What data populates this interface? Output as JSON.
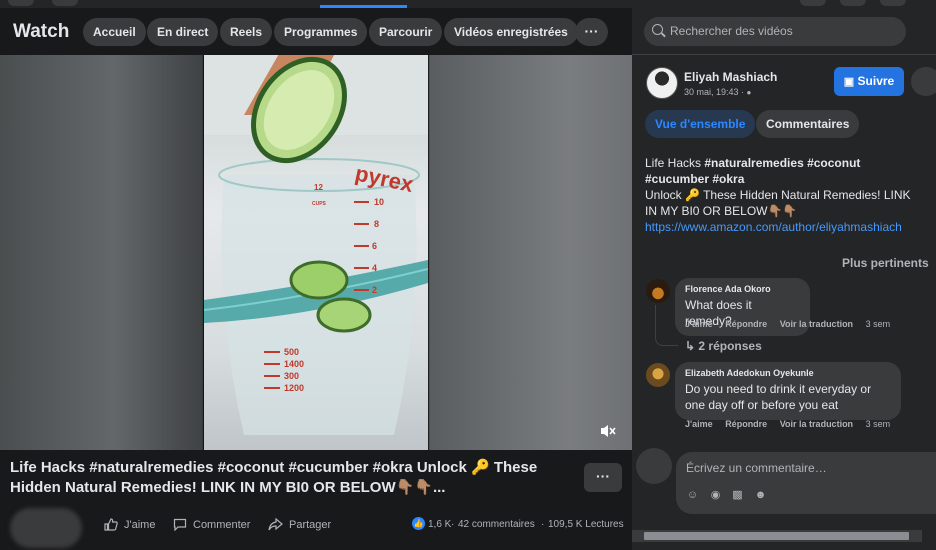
{
  "nav": {
    "title": "Watch",
    "tabs": [
      "Accueil",
      "En direct",
      "Reels",
      "Programmes",
      "Parcourir",
      "Vidéos enregistrées"
    ],
    "more": "···"
  },
  "search": {
    "placeholder": "Rechercher des vidéos"
  },
  "video": {
    "caption": "Life Hacks #naturalremedies #coconut #cucumber #okra Unlock 🔑 These Hidden Natural Remedies! LINK IN MY BI0 OR BELOW👇🏽👇🏽...",
    "more": "···",
    "actions": {
      "like": "J'aime",
      "comment": "Commenter",
      "share": "Partager"
    },
    "stats": {
      "reactions": "1,6 K",
      "comments": "42 commentaires",
      "views": "109,5 K Lectures",
      "separator": "·"
    },
    "beaker_brand": "pyrex",
    "beaker_marks": [
      "12",
      "CUPS",
      "10",
      "8",
      "6",
      "4",
      "2",
      "500",
      "1400",
      "300",
      "1200"
    ]
  },
  "post": {
    "author": "Eliyah Mashiach",
    "date": "30 mai, 19:43 · ",
    "follow": "Suivre",
    "tabs": {
      "overview": "Vue d'ensemble",
      "comments": "Commentaires"
    },
    "desc_prefix": "Life Hacks ",
    "desc_tags": "#naturalremedies #coconut #cucumber #okra",
    "desc_body": "Unlock 🔑 These Hidden Natural Remedies! LINK IN MY BI0 OR BELOW👇🏽👇🏽",
    "desc_link": "https://www.amazon.com/author/eliyahmashiach",
    "sort": "Plus pertinents"
  },
  "comments": [
    {
      "name": "Florence Ada Okoro",
      "text": "What does it remedy?",
      "like": "J'aime",
      "reply": "Répondre",
      "translate": "Voir la traduction",
      "time": "3 sem",
      "replies": "2 réponses"
    },
    {
      "name": "Elizabeth Adedokun Oyekunle",
      "text": "Do you need to drink it everyday or one day off or before you eat",
      "like": "J'aime",
      "reply": "Répondre",
      "translate": "Voir la traduction",
      "time": "3 sem"
    }
  ],
  "compose": {
    "placeholder": "Écrivez un commentaire…"
  },
  "colors": {
    "accent": "#2d88ff",
    "follow_bg": "#2374e1",
    "bg": "#18191a",
    "panel": "#242526"
  }
}
